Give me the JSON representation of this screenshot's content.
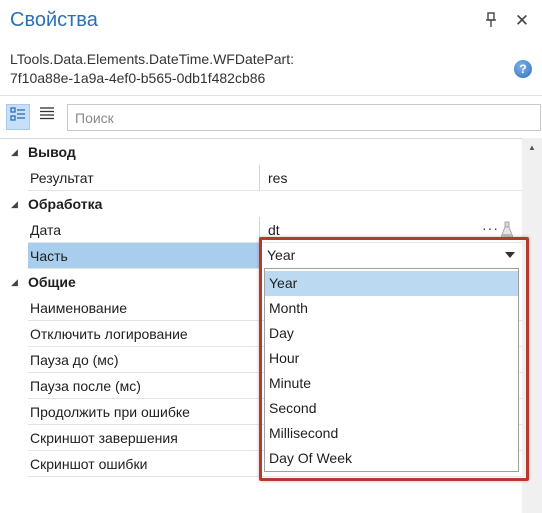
{
  "panel": {
    "title": "Свойства",
    "pin_glyph": "⊥",
    "close_glyph": "✕",
    "type_name": "LTools.Data.Elements.DateTime.WFDatePart:\n7f10a88e-1a9a-4ef0-b565-0db1f482cb86",
    "help_glyph": "?"
  },
  "toolbar": {
    "categorized_icon": "categorized-view-icon",
    "alphabetical_icon": "alphabetical-view-icon",
    "search_placeholder": "Поиск",
    "search_value": ""
  },
  "grid": {
    "categories": [
      {
        "label": "Вывод",
        "properties": [
          {
            "label": "Результат",
            "value": "res"
          }
        ]
      },
      {
        "label": "Обработка",
        "properties": [
          {
            "label": "Дата",
            "value": "dt"
          },
          {
            "label": "Часть",
            "value": "Year"
          }
        ]
      },
      {
        "label": "Общие",
        "properties": [
          {
            "label": "Наименование",
            "value": ""
          },
          {
            "label": "Отключить логирование",
            "value": ""
          },
          {
            "label": "Пауза до (мс)",
            "value": ""
          },
          {
            "label": "Пауза после (мс)",
            "value": ""
          },
          {
            "label": "Продолжить при ошибке",
            "value": ""
          },
          {
            "label": "Скриншот завершения",
            "value": ""
          },
          {
            "label": "Скриншот ошибки",
            "value": ""
          }
        ]
      }
    ],
    "ellipsis": "···"
  },
  "dropdown": {
    "selected": "Year",
    "options": [
      "Year",
      "Month",
      "Day",
      "Hour",
      "Minute",
      "Second",
      "Millisecond",
      "Day Of Week"
    ]
  },
  "colors": {
    "title": "#2a6fb8",
    "selected_row": "#a9cdec",
    "highlight_frame": "#b43a2c"
  }
}
